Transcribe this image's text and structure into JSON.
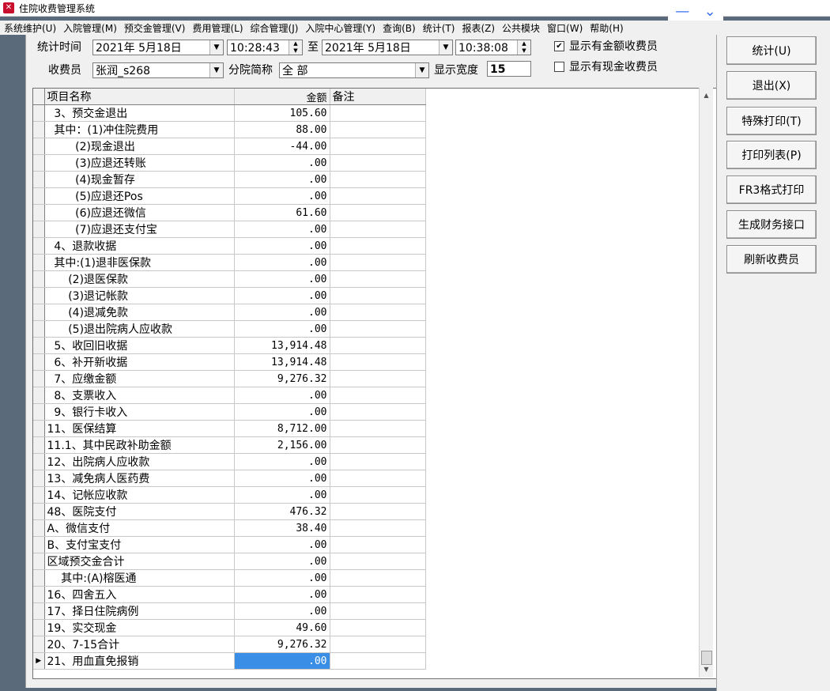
{
  "app": {
    "title": "住院收费管理系统",
    "icon": "app-logo-icon"
  },
  "window_buttons": {
    "minimize": "—",
    "dropdown": "⌄"
  },
  "menu": [
    "系统维护(U)",
    "入院管理(M)",
    "预交金管理(V)",
    "费用管理(L)",
    "综合管理(J)",
    "入院中心管理(Y)",
    "查询(B)",
    "统计(T)",
    "报表(Z)",
    "公共模块",
    "窗口(W)",
    "帮助(H)"
  ],
  "filters": {
    "stat_time_label": "统计时间",
    "date_from": "2021年 5月18日",
    "time_from": "10:28:43",
    "to_label": "至",
    "date_to": "2021年 5月18日",
    "time_to": "10:38:08",
    "cashier_label": "收费员",
    "cashier_value": "张润_s268",
    "branch_label": "分院简称",
    "branch_value": "全 部",
    "width_label": "显示宽度",
    "width_value": "15",
    "show_amount_label": "显示有金额收费员",
    "show_amount_checked": true,
    "show_cash_label": "显示有现金收费员",
    "show_cash_checked": false
  },
  "buttons": {
    "stat": "统计(U)",
    "exit": "退出(X)",
    "special_print": "特殊打印(T)",
    "print_list": "打印列表(P)",
    "fr3_print": "FR3格式打印",
    "finance_interface": "生成财务接口",
    "refresh_cashier": "刷新收费员"
  },
  "table": {
    "headers": [
      "项目名称",
      "金额",
      "备注"
    ],
    "rows": [
      [
        "  3、预交金退出",
        "105.60",
        ""
      ],
      [
        "  其中：(1)冲住院费用",
        "88.00",
        ""
      ],
      [
        "        (2)现金退出",
        "-44.00",
        ""
      ],
      [
        "        (3)应退还转账",
        ".00",
        ""
      ],
      [
        "        (4)现金暂存",
        ".00",
        ""
      ],
      [
        "        (5)应退还Pos",
        ".00",
        ""
      ],
      [
        "        (6)应退还微信",
        "61.60",
        ""
      ],
      [
        "        (7)应退还支付宝",
        ".00",
        ""
      ],
      [
        "  4、退款收据",
        ".00",
        ""
      ],
      [
        "  其中:(1)退非医保款",
        ".00",
        ""
      ],
      [
        "      (2)退医保款",
        ".00",
        ""
      ],
      [
        "      (3)退记帐款",
        ".00",
        ""
      ],
      [
        "      (4)退减免款",
        ".00",
        ""
      ],
      [
        "      (5)退出院病人应收款",
        ".00",
        ""
      ],
      [
        "  5、收回旧收据",
        "13,914.48",
        ""
      ],
      [
        "  6、补开新收据",
        "13,914.48",
        ""
      ],
      [
        "  7、应缴金额",
        "9,276.32",
        ""
      ],
      [
        "  8、支票收入",
        ".00",
        ""
      ],
      [
        "  9、银行卡收入",
        ".00",
        ""
      ],
      [
        "11、医保结算",
        "8,712.00",
        ""
      ],
      [
        "11.1、其中民政补助金额",
        "2,156.00",
        ""
      ],
      [
        "12、出院病人应收款",
        ".00",
        ""
      ],
      [
        "13、减免病人医药费",
        ".00",
        ""
      ],
      [
        "14、记帐应收款",
        ".00",
        ""
      ],
      [
        "48、医院支付",
        "476.32",
        ""
      ],
      [
        "A、微信支付",
        "38.40",
        ""
      ],
      [
        "B、支付宝支付",
        ".00",
        ""
      ],
      [
        "区域预交金合计",
        ".00",
        ""
      ],
      [
        "    其中:(A)榕医通",
        ".00",
        ""
      ],
      [
        "16、四舍五入",
        ".00",
        ""
      ],
      [
        "17、择日住院病例",
        ".00",
        ""
      ],
      [
        "19、实交现金",
        "49.60",
        ""
      ],
      [
        "20、7-15合计",
        "9,276.32",
        ""
      ],
      [
        "21、用血直免报销",
        ".00",
        ""
      ]
    ],
    "current_row_marker": "▶"
  },
  "colors": {
    "selection": "#3a8ee6",
    "accent": "#3a6ff0",
    "logo": "#c8102e"
  }
}
